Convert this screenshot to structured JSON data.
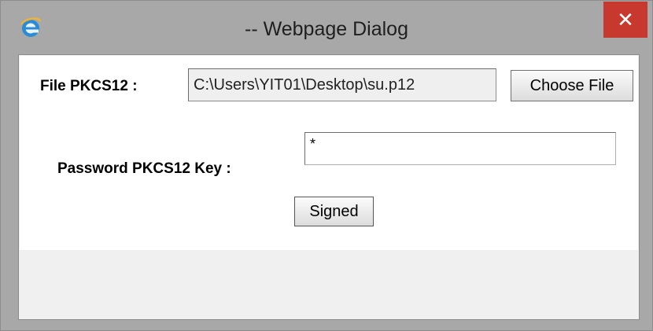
{
  "window": {
    "title": "-- Webpage Dialog",
    "close_label": "✕"
  },
  "icons": {
    "app": "ie-logo-icon",
    "close": "close-icon"
  },
  "form": {
    "file_label": "File PKCS12 :",
    "file_value": "C:\\Users\\YIT01\\Desktop\\su.p12",
    "choose_button": "Choose File",
    "password_label": "Password PKCS12 Key :",
    "password_value": "*",
    "submit_button": "Signed"
  },
  "colors": {
    "close_button": "#c7382e",
    "chrome": "#a8a8a8",
    "content_bg": "#ffffff",
    "footer_bg": "#f0f0f0"
  }
}
